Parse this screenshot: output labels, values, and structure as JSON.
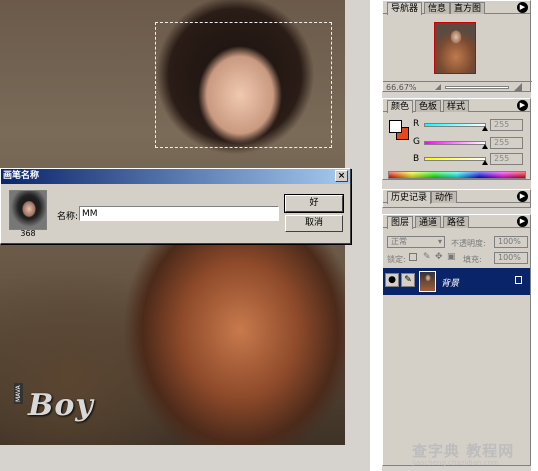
{
  "dialog": {
    "title": "画笔名称",
    "close": "×",
    "brush_size": "368",
    "name_label": "名称:",
    "name_value": "MM",
    "ok_label": "好",
    "cancel_label": "取消"
  },
  "canvas": {
    "logo_big": "Boy",
    "logo_small": "MAVA"
  },
  "watermark": {
    "line1": "查字典 教程网",
    "line2": "jiaocheng.chazidian.com"
  },
  "navigator": {
    "tabs": [
      "导航器",
      "信息",
      "直方图"
    ],
    "zoom": "66.67%"
  },
  "color": {
    "tabs": [
      "颜色",
      "色板",
      "样式"
    ],
    "channels": [
      {
        "label": "R",
        "value": "255"
      },
      {
        "label": "G",
        "value": "255"
      },
      {
        "label": "B",
        "value": "255"
      }
    ],
    "foreground": "#ffffff",
    "background": "#e8461e"
  },
  "history": {
    "tabs": [
      "历史记录",
      "动作"
    ]
  },
  "layers": {
    "tabs": [
      "图层",
      "通道",
      "路径"
    ],
    "blend_mode": "正常",
    "opacity_label": "不透明度:",
    "opacity": "100%",
    "lock_label": "锁定:",
    "fill_label": "填充:",
    "fill": "100%",
    "layer_name": "背景"
  }
}
